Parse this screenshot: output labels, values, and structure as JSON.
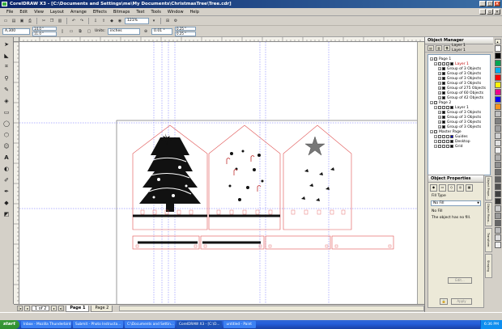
{
  "window": {
    "title": "CorelDRAW X3 - [C:\\Documents and Settings\\me\\My Documents\\ChristmasTree\\Tree.cdr]"
  },
  "menu": [
    "File",
    "Edit",
    "View",
    "Layout",
    "Arrange",
    "Effects",
    "Bitmaps",
    "Text",
    "Tools",
    "Window",
    "Help"
  ],
  "toolbar": {
    "zoom": "121%"
  },
  "propbar": {
    "page_size": "A,300",
    "width": "14.0 \"",
    "height": "11.0 \"",
    "units_label": "Units:",
    "units_value": "inches",
    "nudge": "0.01 \"",
    "dup_x": "0.25 \"",
    "dup_y": "0.25 \""
  },
  "pages": {
    "count": "1 of 2",
    "tabs": [
      "Page 1",
      "Page 2"
    ]
  },
  "docker": {
    "title": "Object Manager",
    "layer_name": "Layer 1",
    "layer_current": "Layer 1",
    "tree": [
      {
        "level": 0,
        "label": "Page 1",
        "icons": 0
      },
      {
        "level": 1,
        "label": "Layer 1",
        "icons": 4,
        "red": true
      },
      {
        "level": 2,
        "label": "Group of 3 Objects",
        "icons": 1
      },
      {
        "level": 2,
        "label": "Group of 3 Objects",
        "icons": 1
      },
      {
        "level": 2,
        "label": "Group of 3 Objects",
        "icons": 1
      },
      {
        "level": 2,
        "label": "Group of 3 Objects",
        "icons": 1
      },
      {
        "level": 2,
        "label": "Group of 275 Objects",
        "icons": 1
      },
      {
        "level": 2,
        "label": "Group of 60 Objects",
        "icons": 1
      },
      {
        "level": 2,
        "label": "Group of 42 Objects",
        "icons": 1
      },
      {
        "level": 0,
        "label": "Page 2",
        "icons": 0
      },
      {
        "level": 1,
        "label": "Layer 1",
        "icons": 4
      },
      {
        "level": 2,
        "label": "Group of 3 Objects",
        "icons": 1
      },
      {
        "level": 2,
        "label": "Group of 3 Objects",
        "icons": 1
      },
      {
        "level": 2,
        "label": "Group of 3 Objects",
        "icons": 1
      },
      {
        "level": 2,
        "label": "Group of 3 Objects",
        "icons": 1
      },
      {
        "level": 0,
        "label": "Master Page",
        "icons": 0
      },
      {
        "level": 1,
        "label": "Guides",
        "icons": 4,
        "blue": true
      },
      {
        "level": 1,
        "label": "Desktop",
        "icons": 4
      },
      {
        "level": 1,
        "label": "Grid",
        "icons": 4
      }
    ]
  },
  "properties": {
    "title": "Object Properties",
    "fill_type_label": "Fill Type",
    "fill_type_value": "No Fill",
    "fill_name": "No Fill",
    "fill_desc": "The object has no fill.",
    "edit_button": "Edit...",
    "apply_button": "Apply",
    "tabs": [
      "Object Prope...",
      "Object Mana...",
      "Transform",
      "Shaping"
    ]
  },
  "palette_colors": [
    "#ffffff",
    "#000000",
    "#00a651",
    "#00aeef",
    "#ff0000",
    "#fff200",
    "#ec008c",
    "#0000ff",
    "#f7941d",
    "#c0c0c0",
    "#808080",
    "#a0a0a0",
    "#d0d0d0",
    "#e0e0e0",
    "#f0f0f0",
    "#b0b0b0",
    "#909090",
    "#707070",
    "#606060",
    "#505050",
    "#404040",
    "#303030",
    "#cccccc",
    "#999999",
    "#666666",
    "#bbbbbb",
    "#dddddd",
    "#eeeeee"
  ],
  "taskbar": {
    "start": "start",
    "tasks": [
      "Inbox - Mozilla Thunderbird",
      "Submit - Photo Instructa...",
      "C:\\Documents and Settin...",
      "CorelDRAW X3 - [C:\\D...",
      "untitled - Paint"
    ],
    "active_index": 3,
    "clock": "6:36 PM"
  }
}
